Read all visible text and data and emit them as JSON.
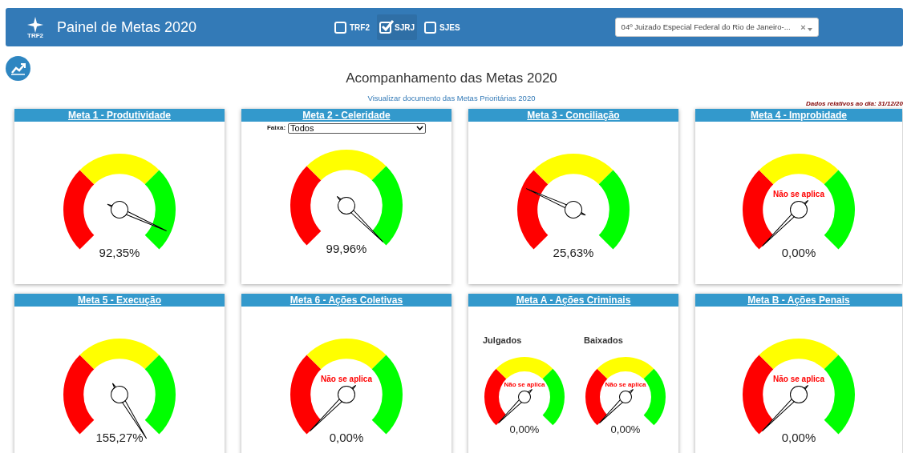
{
  "header": {
    "logo_text": "TRF2",
    "title": "Painel de Metas 2020",
    "filters": [
      {
        "label": "TRF2",
        "checked": false
      },
      {
        "label": "SJRJ",
        "checked": true
      },
      {
        "label": "SJES",
        "checked": false
      }
    ],
    "unit_select": {
      "value": "04º Juizado Especial Federal do Rio de Janeiro-...",
      "clear": "×"
    }
  },
  "page_title": "Acompanhamento das Metas 2020",
  "document_link": "Visualizar documento das Metas Prioritárias 2020",
  "data_date": "Dados relativos ao dia: 31/12/20",
  "cards": [
    {
      "title": "Meta 1 - Produtividade",
      "gauges": [
        {
          "reading": "92,35%"
        }
      ]
    },
    {
      "title": "Meta 2 - Celeridade",
      "filter": {
        "label": "Faixa:",
        "value": "Todos"
      },
      "gauges": [
        {
          "reading": "99,96%"
        }
      ]
    },
    {
      "title": "Meta 3 - Conciliação",
      "gauges": [
        {
          "reading": "25,63%"
        }
      ]
    },
    {
      "title": "Meta 4 - Improbidade",
      "gauges": [
        {
          "reading": "0,00%",
          "note": "Não se aplica"
        }
      ]
    },
    {
      "title": "Meta 5 - Execução",
      "gauges": [
        {
          "reading": "155,27%"
        }
      ]
    },
    {
      "title": "Meta 6 - Ações Coletivas",
      "gauges": [
        {
          "reading": "0,00%",
          "note": "Não se aplica"
        }
      ]
    },
    {
      "title": "Meta A - Ações Criminais",
      "gauges": [
        {
          "label": "Julgados",
          "reading": "0,00%",
          "note": "Não se aplica"
        },
        {
          "label": "Baixados",
          "reading": "0,00%",
          "note": "Não se aplica"
        }
      ]
    },
    {
      "title": "Meta B - Ações Penais",
      "gauges": [
        {
          "reading": "0,00%",
          "note": "Não se aplica"
        }
      ]
    }
  ]
}
